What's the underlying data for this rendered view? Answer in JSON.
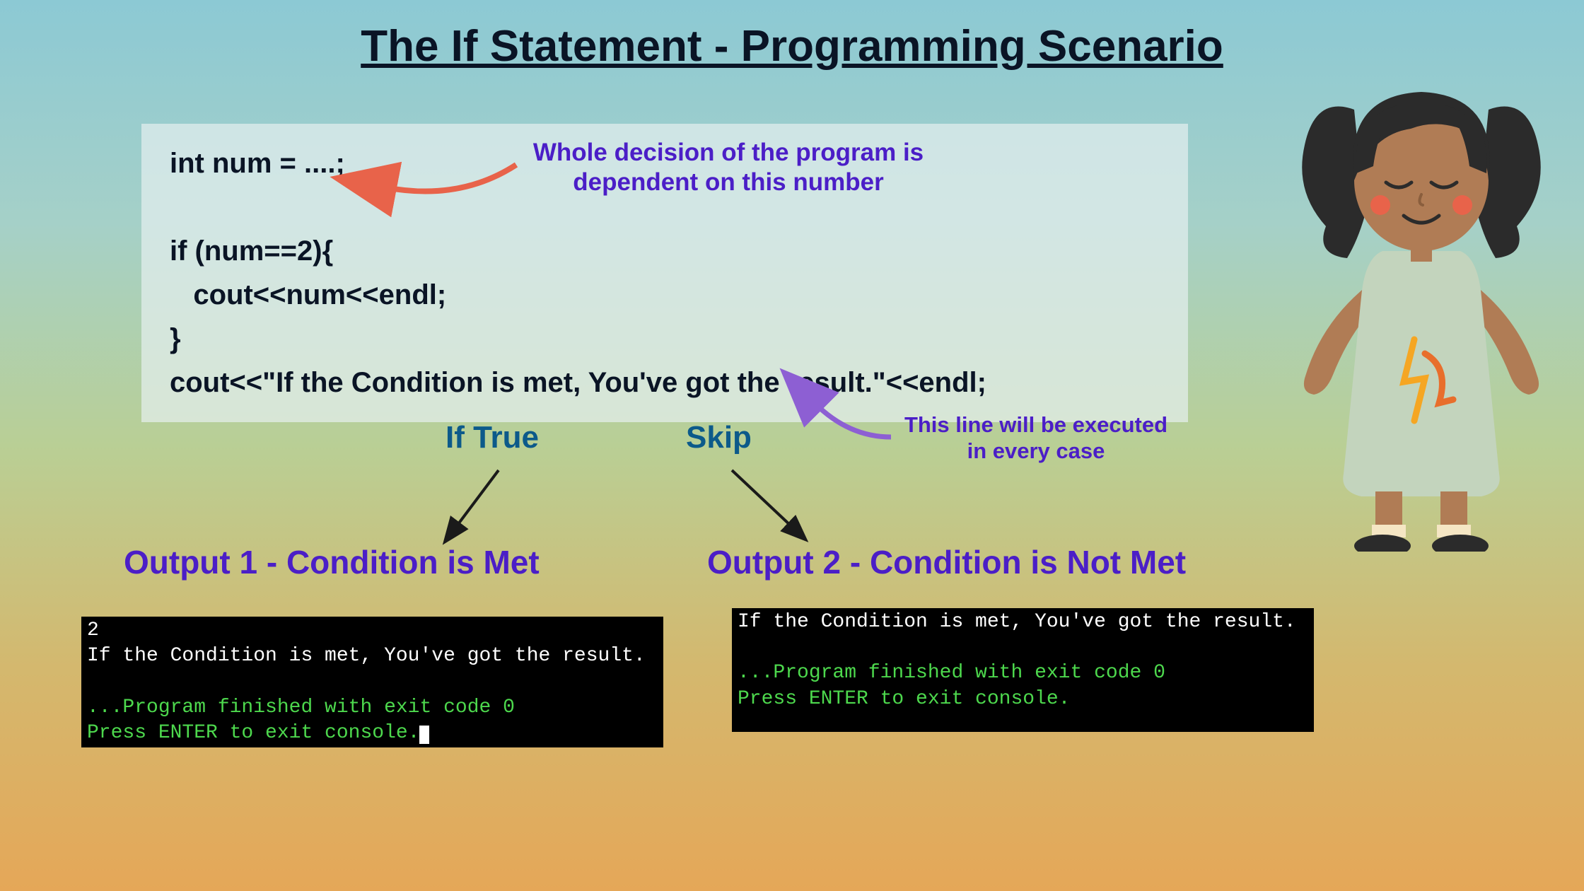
{
  "title": "The If Statement - Programming Scenario",
  "code": {
    "line1": "int num = ....;",
    "line2": "if (num==2){",
    "line3": "   cout<<num<<endl;",
    "line4": "}",
    "line5": "cout<<\"If the Condition is met, You've got the result.\"<<endl;"
  },
  "annotations": {
    "decision": "Whole decision of the program is\ndependent on this number",
    "ifTrue": "If True",
    "skip": "Skip",
    "everyCase": "This line will be executed\nin every case"
  },
  "outputs": {
    "heading1": "Output 1 - Condition is Met",
    "heading2": "Output 2 - Condition is Not Met",
    "console1": {
      "line1": "2",
      "line2": "If the Condition is met, You've got the result.",
      "line3": "...Program finished with exit code 0",
      "line4": "Press ENTER to exit console."
    },
    "console2": {
      "line1": "If the Condition is met, You've got the result.",
      "line2": "...Program finished with exit code 0",
      "line3": "Press ENTER to exit console."
    }
  }
}
